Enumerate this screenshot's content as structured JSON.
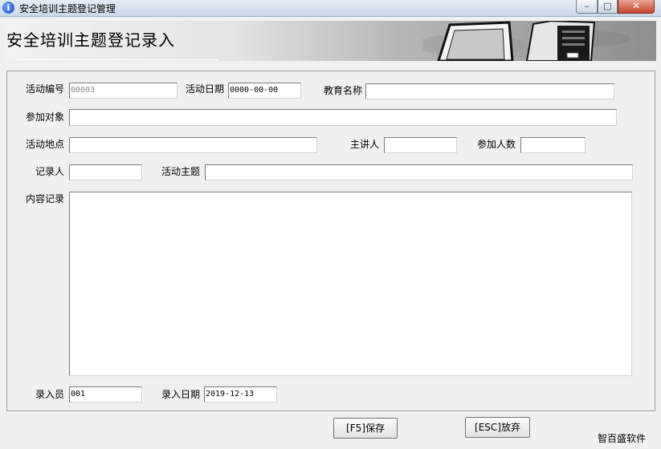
{
  "window": {
    "title": "安全培训主题登记管理",
    "min_glyph": "–",
    "max_glyph": "□",
    "close_glyph": "✕"
  },
  "banner": {
    "title": "安全培训主题登记录入"
  },
  "form": {
    "activity_no": {
      "label": "活动编号",
      "value": "00003"
    },
    "activity_date": {
      "label": "活动日期",
      "value": "0000-00-00"
    },
    "education_name": {
      "label": "教育名称",
      "value": ""
    },
    "participants": {
      "label": "参加对象",
      "value": ""
    },
    "location": {
      "label": "活动地点",
      "value": ""
    },
    "speaker": {
      "label": "主讲人",
      "value": ""
    },
    "attendee_count": {
      "label": "参加人数",
      "value": ""
    },
    "recorder": {
      "label": "记录人",
      "value": ""
    },
    "theme": {
      "label": "活动主题",
      "value": ""
    },
    "content": {
      "label": "内容记录",
      "value": ""
    },
    "entry_person": {
      "label": "录入员",
      "value": "001"
    },
    "entry_date": {
      "label": "录入日期",
      "value": "2019-12-13"
    }
  },
  "actions": {
    "save_label": "[F5]保存",
    "cancel_label": "[ESC]放弃"
  },
  "footer": {
    "brand": "智百盛软件"
  }
}
